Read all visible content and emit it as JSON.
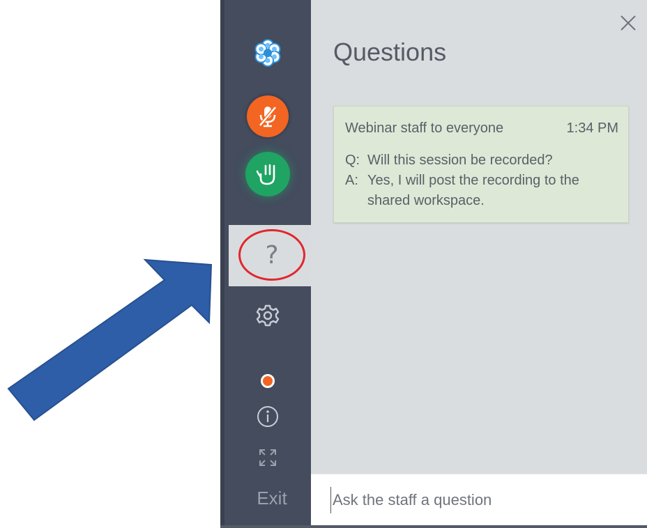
{
  "panel": {
    "title": "Questions",
    "close_icon": "close-icon"
  },
  "sidebar": {
    "logo_icon": "gotowebinar-flower-logo-icon",
    "mute_icon": "microphone-muted-icon",
    "hand_icon": "raise-hand-icon",
    "questions_icon": "question-mark-icon",
    "questions_glyph": "?",
    "settings_icon": "gear-icon",
    "recording_icon": "recording-dot-icon",
    "info_icon": "info-icon",
    "expand_icon": "expand-arrows-icon",
    "exit_label": "Exit"
  },
  "qa_card": {
    "sender": "Webinar staff to everyone",
    "time": "1:34 PM",
    "q_prefix": "Q:",
    "question": "Will this session be recorded?",
    "a_prefix": "A:",
    "answer": "Yes, I will post the recording to the shared workspace."
  },
  "input": {
    "placeholder": "Ask the staff a question",
    "value": ""
  },
  "colors": {
    "sidebar_bg": "#444c5e",
    "panel_bg": "#dadddf",
    "card_bg": "#dde9d6",
    "mute_orange": "#f26522",
    "hand_green": "#1fa463",
    "highlight_ring": "#e2262b",
    "arrow_blue": "#2e5ea8"
  }
}
